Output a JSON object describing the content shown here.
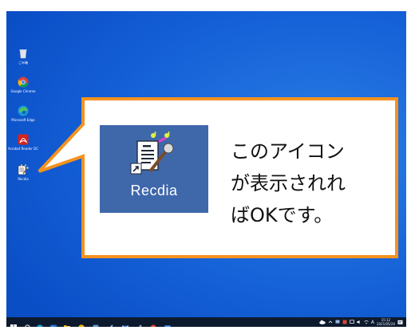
{
  "desktop": {
    "icons": [
      {
        "name": "recycle-bin",
        "label": "ごみ箱"
      },
      {
        "name": "google-chrome",
        "label": "Google Chrome"
      },
      {
        "name": "microsoft-edge",
        "label": "Microsoft Edge"
      },
      {
        "name": "acrobat-reader",
        "label": "Acrobat Reader DC"
      },
      {
        "name": "recdia",
        "label": "Recdia"
      }
    ]
  },
  "callout": {
    "app_label": "Recdia",
    "message_lines": [
      "このアイコン",
      "が表示されれ",
      "ばOKです。"
    ],
    "border_color": "#f5921e",
    "app_box_color": "#3f68ab"
  },
  "taskbar": {
    "tray_ime": "A",
    "clock_time": "15:12",
    "clock_date": "2021/05/26"
  }
}
